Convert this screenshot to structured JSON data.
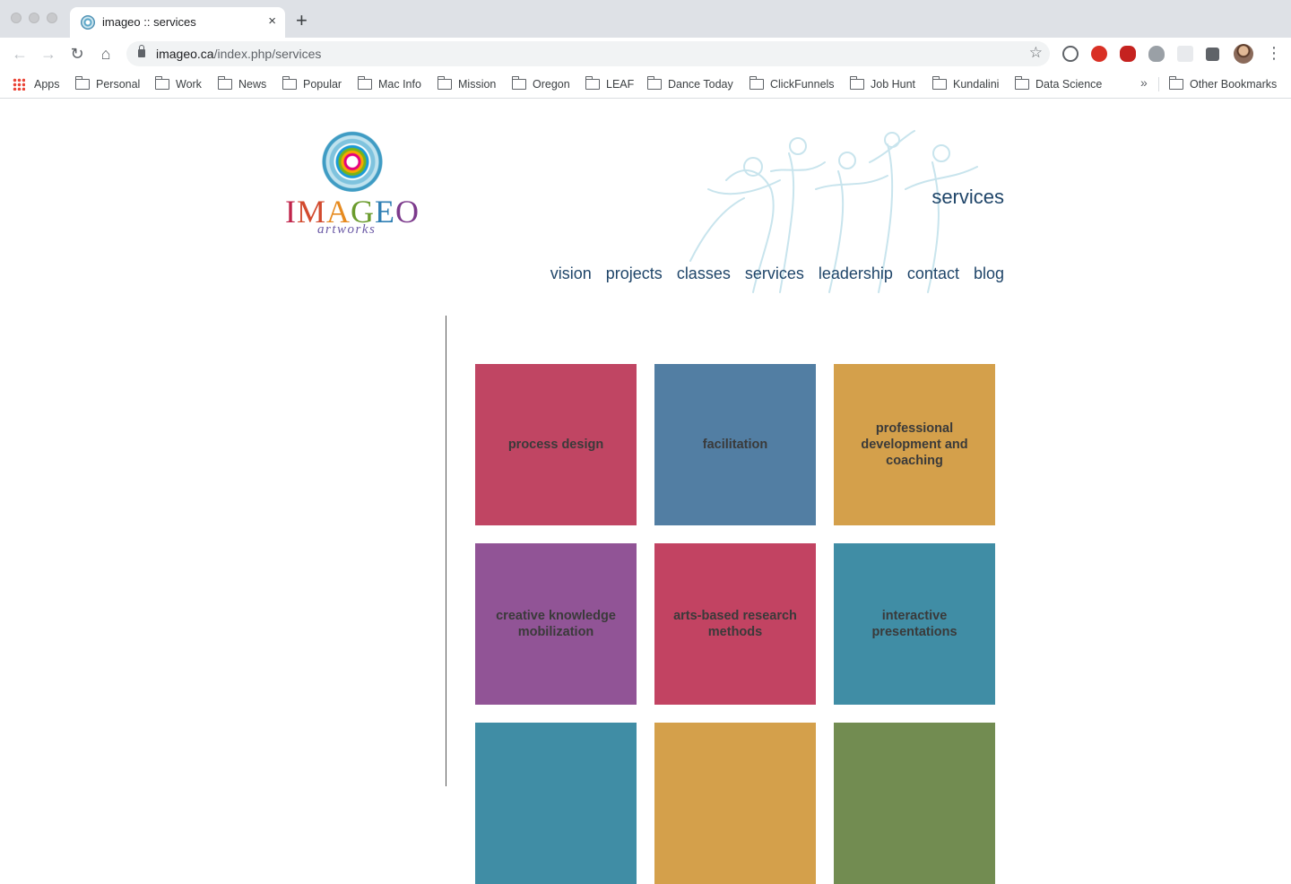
{
  "browser": {
    "tab_title": "imageo :: services",
    "new_tab_label": "+",
    "close_label": "×",
    "url_host": "imageo.ca",
    "url_path": "/index.php/services",
    "bookmarks": [
      "Apps",
      "Personal",
      "Work",
      "News",
      "Popular",
      "Mac Info",
      "Mission",
      "Oregon",
      "LEAF",
      "Dance Today",
      "ClickFunnels",
      "Job Hunt",
      "Kundalini",
      "Data Science"
    ],
    "overflow_label": "»",
    "other_bookmarks": "Other Bookmarks"
  },
  "site": {
    "logo_word": [
      "I",
      "M",
      "A",
      "G",
      "E",
      "O"
    ],
    "logo_sub": "artworks",
    "heading": "services",
    "nav": [
      "vision",
      "projects",
      "classes",
      "services",
      "leadership",
      "contact",
      "blog"
    ]
  },
  "tiles": [
    {
      "label": "process design",
      "color": "#c04563"
    },
    {
      "label": "facilitation",
      "color": "#527ea3"
    },
    {
      "label": "professional development and coaching",
      "color": "#d4a04b"
    },
    {
      "label": "creative knowledge mobilization",
      "color": "#915496"
    },
    {
      "label": "arts-based research methods",
      "color": "#c24362"
    },
    {
      "label": "interactive presentations",
      "color": "#408da5"
    },
    {
      "label": "",
      "color": "#408da5"
    },
    {
      "label": "",
      "color": "#d4a04b"
    },
    {
      "label": "",
      "color": "#728c51"
    }
  ]
}
